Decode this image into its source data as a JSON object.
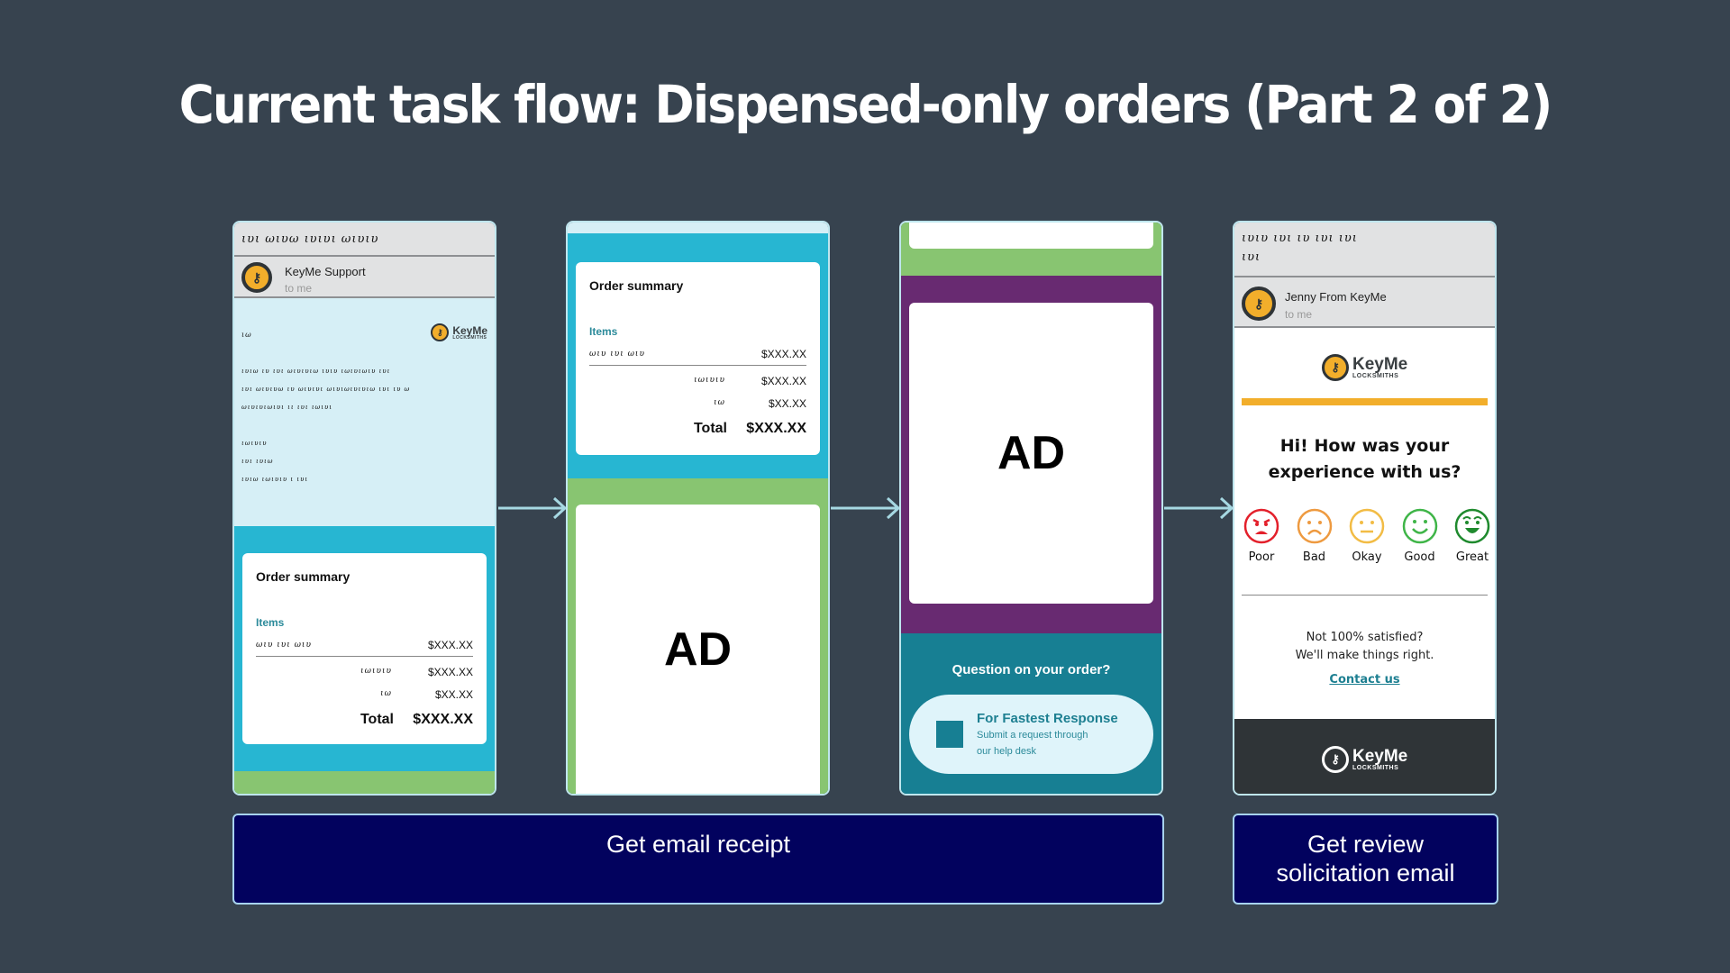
{
  "title": "Current task flow: Dispensed-only orders (Part 2 of 2)",
  "colors": {
    "background": "#37434f",
    "label_bar": "#02025e",
    "keyme_yellow": "#f2ae2b",
    "teal": "#27b6d2",
    "green": "#88c571",
    "purple": "#682a71",
    "dark_teal": "#177f93"
  },
  "screen1": {
    "subject_scribble": "ιυι ωιυω ιυιυι ωιυιυ",
    "sender": "KeyMe Support",
    "to": "to me",
    "logo": {
      "name": "KeyMe",
      "sub": "LOCKSMITHS"
    },
    "greeting_scribble": "ιω",
    "body_lines": [
      "ιυιω ιυ ιυι ωιυιυιω ιυιυ ιωιυιωιυ ιυι",
      "ιυι ωιυιυω ιυ ωιυιυι ωιυιωιυιυιω ιυι ιυ ω",
      "ωιυιυιωιυι ιι ιυι ιωιυι"
    ],
    "signoff_lines": [
      "ιωιυιυ",
      "ιυι ιυιω",
      "ιυιω ιωιυιυ ι ιυι"
    ],
    "order_summary": {
      "title": "Order summary",
      "items_label": "Items",
      "item_scribble": "ωιυ ιυι ωιυ",
      "item_price": "$XXX.XX",
      "rows": [
        {
          "label": "ιωιυιυ",
          "value": "$XXX.XX"
        },
        {
          "label": "ιω",
          "value": "$XX.XX"
        }
      ],
      "total_label": "Total",
      "total_value": "$XXX.XX"
    }
  },
  "screen2": {
    "order_summary": {
      "title": "Order summary",
      "items_label": "Items",
      "item_scribble": "ωιυ ιυι ωιυ",
      "item_price": "$XXX.XX",
      "rows": [
        {
          "label": "ιωιυιυ",
          "value": "$XXX.XX"
        },
        {
          "label": "ιω",
          "value": "$XX.XX"
        }
      ],
      "total_label": "Total",
      "total_value": "$XXX.XX"
    },
    "ad_label": "AD"
  },
  "screen3": {
    "ad_label": "AD",
    "question": "Question on your order?",
    "cta_title": "For Fastest Response",
    "cta_line1": "Submit a request through",
    "cta_line2": "our help desk"
  },
  "screen4": {
    "subject_scribble_1": "ιυιυ ιυι ιυ ιυι ιυι",
    "subject_scribble_2": "ιυι",
    "sender": "Jenny From KeyMe",
    "to": "to me",
    "logo": {
      "name": "KeyMe",
      "sub": "LOCKSMITHS"
    },
    "heading_1": "Hi! How was your",
    "heading_2": "experience with us?",
    "ratings": [
      {
        "label": "Poor",
        "color": "#e3202b",
        "mood": "angry"
      },
      {
        "label": "Bad",
        "color": "#ee9a40",
        "mood": "sad"
      },
      {
        "label": "Okay",
        "color": "#f2bc45",
        "mood": "neutral"
      },
      {
        "label": "Good",
        "color": "#3fb548",
        "mood": "happy"
      },
      {
        "label": "Great",
        "color": "#1f8a2e",
        "mood": "excited"
      }
    ],
    "not_satisfied_1": "Not 100% satisfied?",
    "not_satisfied_2": "We'll make things right.",
    "contact_link": "Contact us",
    "footer_logo": {
      "name": "KeyMe",
      "sub": "LOCKSMITHS"
    }
  },
  "labels": {
    "step1": "Get email receipt",
    "step2_line1": "Get review",
    "step2_line2": "solicitation email"
  }
}
